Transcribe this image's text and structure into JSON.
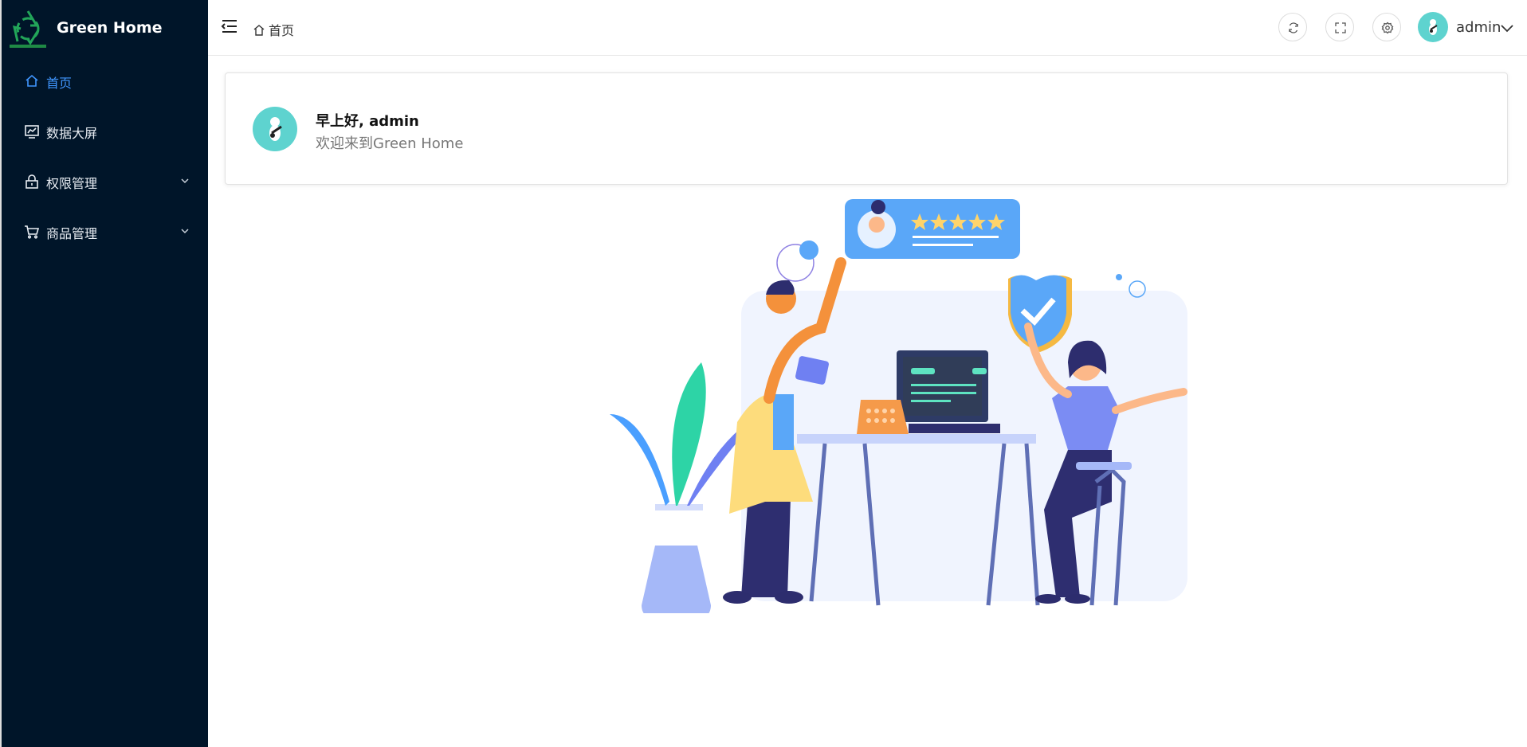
{
  "brand": {
    "title": "Green Home"
  },
  "sidebar": {
    "items": [
      {
        "label": "首页",
        "icon": "home-icon",
        "active": true
      },
      {
        "label": "数据大屏",
        "icon": "chart-icon",
        "active": false
      },
      {
        "label": "权限管理",
        "icon": "lock-icon",
        "active": false,
        "expandable": true
      },
      {
        "label": "商品管理",
        "icon": "cart-icon",
        "active": false,
        "expandable": true
      }
    ]
  },
  "header": {
    "breadcrumb": "首页",
    "user": {
      "name": "admin"
    },
    "actions": [
      "refresh-icon",
      "fullscreen-icon",
      "settings-icon"
    ]
  },
  "welcome": {
    "greeting": "早上好, admin",
    "message": "欢迎来到Green Home"
  },
  "colors": {
    "sidebar_bg": "#001529",
    "accent": "#4096ff",
    "avatar_bg": "#5ed3cf"
  }
}
